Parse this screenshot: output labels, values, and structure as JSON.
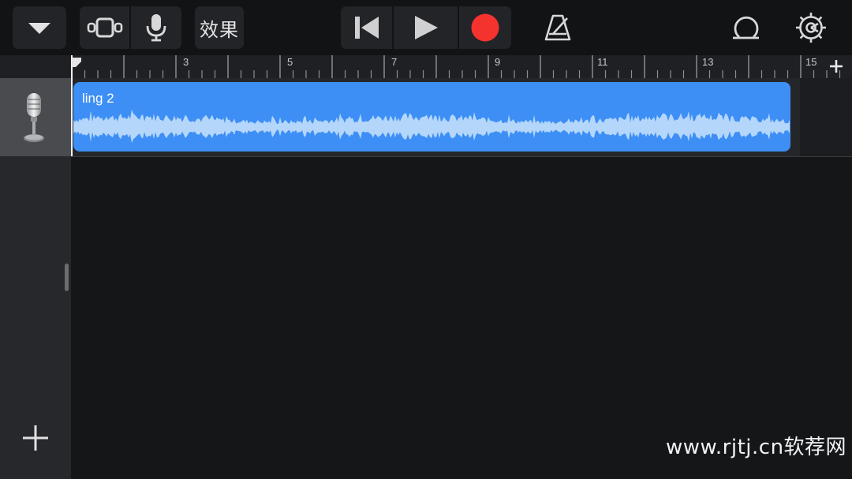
{
  "toolbar": {
    "menu_icon": "chevron-down-icon",
    "view_icon": "tracks-view-icon",
    "mic_icon": "microphone-icon",
    "effects_label": "效果",
    "rewind_icon": "go-to-start-icon",
    "play_icon": "play-icon",
    "record_icon": "record-icon",
    "metronome_icon": "metronome-icon",
    "loop_icon": "loop-browser-icon",
    "settings_icon": "gear-icon"
  },
  "ruler": {
    "bar_numbers": [
      "3",
      "5",
      "7",
      "9",
      "11",
      "13",
      "15"
    ],
    "add_section_icon": "plus-icon"
  },
  "tracks": [
    {
      "instrument_icon": "microphone-instrument-icon",
      "region_name": "ling 2"
    }
  ],
  "sidebar": {
    "add_track_icon": "plus-icon"
  },
  "watermark": "www.rjtj.cn软荐网",
  "colors": {
    "region": "#3d8ff5",
    "waveform": "#b4d6fb",
    "record": "#f4332f",
    "background": "#151618"
  }
}
